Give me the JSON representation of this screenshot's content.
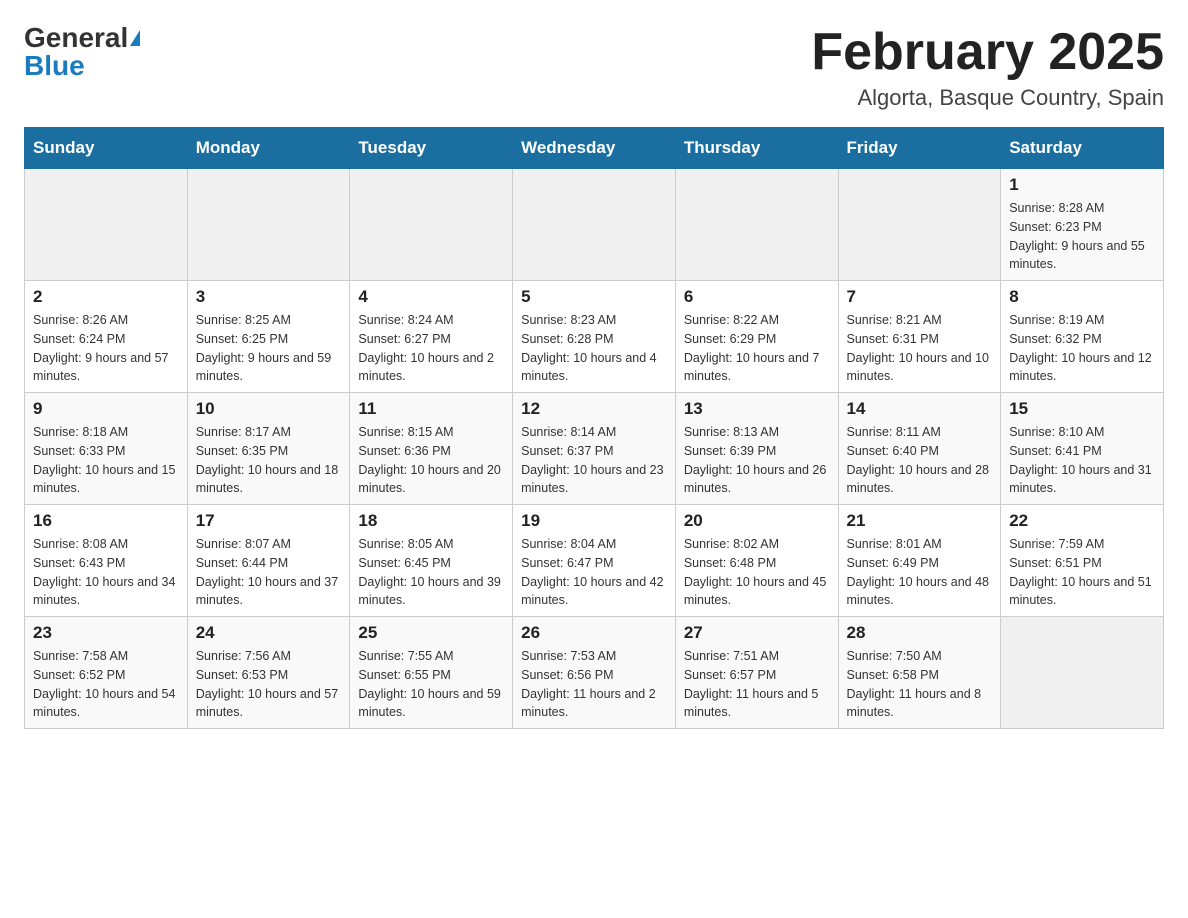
{
  "header": {
    "logo_general": "General",
    "logo_blue": "Blue",
    "month_title": "February 2025",
    "location": "Algorta, Basque Country, Spain"
  },
  "weekdays": [
    "Sunday",
    "Monday",
    "Tuesday",
    "Wednesday",
    "Thursday",
    "Friday",
    "Saturday"
  ],
  "rows": [
    {
      "cells": [
        {
          "day": "",
          "empty": true
        },
        {
          "day": "",
          "empty": true
        },
        {
          "day": "",
          "empty": true
        },
        {
          "day": "",
          "empty": true
        },
        {
          "day": "",
          "empty": true
        },
        {
          "day": "",
          "empty": true
        },
        {
          "day": "1",
          "sunrise": "Sunrise: 8:28 AM",
          "sunset": "Sunset: 6:23 PM",
          "daylight": "Daylight: 9 hours and 55 minutes."
        }
      ]
    },
    {
      "cells": [
        {
          "day": "2",
          "sunrise": "Sunrise: 8:26 AM",
          "sunset": "Sunset: 6:24 PM",
          "daylight": "Daylight: 9 hours and 57 minutes."
        },
        {
          "day": "3",
          "sunrise": "Sunrise: 8:25 AM",
          "sunset": "Sunset: 6:25 PM",
          "daylight": "Daylight: 9 hours and 59 minutes."
        },
        {
          "day": "4",
          "sunrise": "Sunrise: 8:24 AM",
          "sunset": "Sunset: 6:27 PM",
          "daylight": "Daylight: 10 hours and 2 minutes."
        },
        {
          "day": "5",
          "sunrise": "Sunrise: 8:23 AM",
          "sunset": "Sunset: 6:28 PM",
          "daylight": "Daylight: 10 hours and 4 minutes."
        },
        {
          "day": "6",
          "sunrise": "Sunrise: 8:22 AM",
          "sunset": "Sunset: 6:29 PM",
          "daylight": "Daylight: 10 hours and 7 minutes."
        },
        {
          "day": "7",
          "sunrise": "Sunrise: 8:21 AM",
          "sunset": "Sunset: 6:31 PM",
          "daylight": "Daylight: 10 hours and 10 minutes."
        },
        {
          "day": "8",
          "sunrise": "Sunrise: 8:19 AM",
          "sunset": "Sunset: 6:32 PM",
          "daylight": "Daylight: 10 hours and 12 minutes."
        }
      ]
    },
    {
      "cells": [
        {
          "day": "9",
          "sunrise": "Sunrise: 8:18 AM",
          "sunset": "Sunset: 6:33 PM",
          "daylight": "Daylight: 10 hours and 15 minutes."
        },
        {
          "day": "10",
          "sunrise": "Sunrise: 8:17 AM",
          "sunset": "Sunset: 6:35 PM",
          "daylight": "Daylight: 10 hours and 18 minutes."
        },
        {
          "day": "11",
          "sunrise": "Sunrise: 8:15 AM",
          "sunset": "Sunset: 6:36 PM",
          "daylight": "Daylight: 10 hours and 20 minutes."
        },
        {
          "day": "12",
          "sunrise": "Sunrise: 8:14 AM",
          "sunset": "Sunset: 6:37 PM",
          "daylight": "Daylight: 10 hours and 23 minutes."
        },
        {
          "day": "13",
          "sunrise": "Sunrise: 8:13 AM",
          "sunset": "Sunset: 6:39 PM",
          "daylight": "Daylight: 10 hours and 26 minutes."
        },
        {
          "day": "14",
          "sunrise": "Sunrise: 8:11 AM",
          "sunset": "Sunset: 6:40 PM",
          "daylight": "Daylight: 10 hours and 28 minutes."
        },
        {
          "day": "15",
          "sunrise": "Sunrise: 8:10 AM",
          "sunset": "Sunset: 6:41 PM",
          "daylight": "Daylight: 10 hours and 31 minutes."
        }
      ]
    },
    {
      "cells": [
        {
          "day": "16",
          "sunrise": "Sunrise: 8:08 AM",
          "sunset": "Sunset: 6:43 PM",
          "daylight": "Daylight: 10 hours and 34 minutes."
        },
        {
          "day": "17",
          "sunrise": "Sunrise: 8:07 AM",
          "sunset": "Sunset: 6:44 PM",
          "daylight": "Daylight: 10 hours and 37 minutes."
        },
        {
          "day": "18",
          "sunrise": "Sunrise: 8:05 AM",
          "sunset": "Sunset: 6:45 PM",
          "daylight": "Daylight: 10 hours and 39 minutes."
        },
        {
          "day": "19",
          "sunrise": "Sunrise: 8:04 AM",
          "sunset": "Sunset: 6:47 PM",
          "daylight": "Daylight: 10 hours and 42 minutes."
        },
        {
          "day": "20",
          "sunrise": "Sunrise: 8:02 AM",
          "sunset": "Sunset: 6:48 PM",
          "daylight": "Daylight: 10 hours and 45 minutes."
        },
        {
          "day": "21",
          "sunrise": "Sunrise: 8:01 AM",
          "sunset": "Sunset: 6:49 PM",
          "daylight": "Daylight: 10 hours and 48 minutes."
        },
        {
          "day": "22",
          "sunrise": "Sunrise: 7:59 AM",
          "sunset": "Sunset: 6:51 PM",
          "daylight": "Daylight: 10 hours and 51 minutes."
        }
      ]
    },
    {
      "cells": [
        {
          "day": "23",
          "sunrise": "Sunrise: 7:58 AM",
          "sunset": "Sunset: 6:52 PM",
          "daylight": "Daylight: 10 hours and 54 minutes."
        },
        {
          "day": "24",
          "sunrise": "Sunrise: 7:56 AM",
          "sunset": "Sunset: 6:53 PM",
          "daylight": "Daylight: 10 hours and 57 minutes."
        },
        {
          "day": "25",
          "sunrise": "Sunrise: 7:55 AM",
          "sunset": "Sunset: 6:55 PM",
          "daylight": "Daylight: 10 hours and 59 minutes."
        },
        {
          "day": "26",
          "sunrise": "Sunrise: 7:53 AM",
          "sunset": "Sunset: 6:56 PM",
          "daylight": "Daylight: 11 hours and 2 minutes."
        },
        {
          "day": "27",
          "sunrise": "Sunrise: 7:51 AM",
          "sunset": "Sunset: 6:57 PM",
          "daylight": "Daylight: 11 hours and 5 minutes."
        },
        {
          "day": "28",
          "sunrise": "Sunrise: 7:50 AM",
          "sunset": "Sunset: 6:58 PM",
          "daylight": "Daylight: 11 hours and 8 minutes."
        },
        {
          "day": "",
          "empty": true
        }
      ]
    }
  ]
}
